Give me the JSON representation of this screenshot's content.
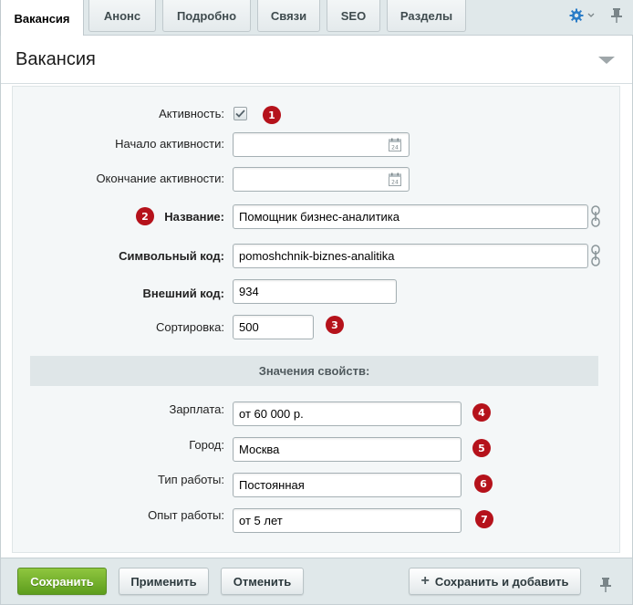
{
  "tabs": [
    {
      "label": "Вакансия",
      "active": true
    },
    {
      "label": "Анонс"
    },
    {
      "label": "Подробно"
    },
    {
      "label": "Связи"
    },
    {
      "label": "SEO"
    },
    {
      "label": "Разделы"
    }
  ],
  "toolbar": {
    "settings_icon": "gear-icon",
    "pin_icon": "pin-icon"
  },
  "section": {
    "title": "Вакансия"
  },
  "form": {
    "active": {
      "label": "Активность:",
      "checked": true,
      "badge": "1"
    },
    "active_from": {
      "label": "Начало активности:",
      "value": ""
    },
    "active_to": {
      "label": "Окончание активности:",
      "value": ""
    },
    "name": {
      "label": "Название:",
      "value": "Помощник бизнес-аналитика",
      "badge": "2"
    },
    "code": {
      "label": "Символьный код:",
      "value": "pomoshchnik-biznes-analitika"
    },
    "xml_id": {
      "label": "Внешний код:",
      "value": "934"
    },
    "sort": {
      "label": "Сортировка:",
      "value": "500",
      "badge": "3"
    },
    "props_header": "Значения свойств:",
    "salary": {
      "label": "Зарплата:",
      "value": "от 60 000 р.",
      "badge": "4"
    },
    "city": {
      "label": "Город:",
      "value": "Москва",
      "badge": "5"
    },
    "work_type": {
      "label": "Тип работы:",
      "value": "Постоянная",
      "badge": "6"
    },
    "experience": {
      "label": "Опыт работы:",
      "value": "от 5 лет",
      "badge": "7"
    }
  },
  "footer": {
    "save": "Сохранить",
    "apply": "Применить",
    "cancel": "Отменить",
    "save_add": "Сохранить и добавить"
  },
  "colors": {
    "accent_green": "#6aab2a",
    "badge_red": "#b5121b",
    "gear_blue": "#2a7cc7"
  }
}
